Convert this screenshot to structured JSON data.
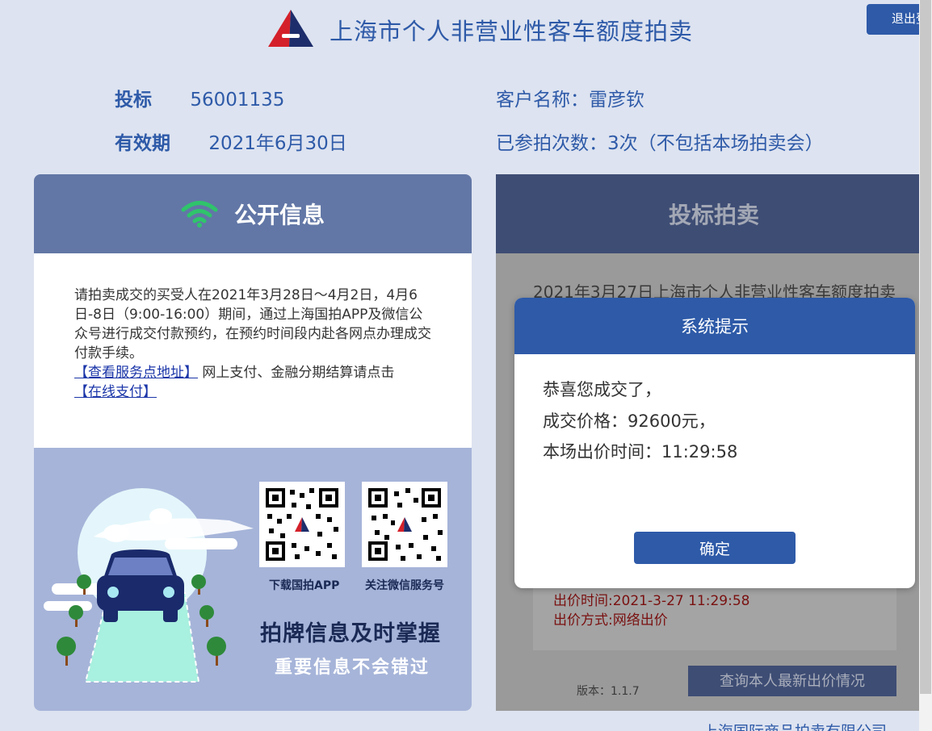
{
  "header": {
    "title": "上海市个人非营业性客车额度拍卖",
    "logout_label": "退出登"
  },
  "user": {
    "bid_no_label": "投标",
    "bid_no": "56001135",
    "valid_label": "有效期",
    "valid_date": "2021年6月30日",
    "customer_label": "客户名称：",
    "customer_name": "雷彦钦",
    "participation_label": "已参拍次数：",
    "participation_value": "3次（不包括本场拍卖会）"
  },
  "public_info": {
    "title": "公开信息",
    "notice_text": "请拍卖成交的买受人在2021年3月28日～4月2日，4月6日-8日（9:00-16:00）期间，通过上海国拍APP及微信公众号进行成交付款预约，在预约时间段内赴各网点办理成交付款手续。",
    "service_link": "【查看服务点地址】",
    "middle_text": " 网上支付、金融分期结算请点击",
    "pay_link": "【在线支付】",
    "qr_app_label": "下载国拍APP",
    "qr_wechat_label": "关注微信服务号",
    "promo_title": "拍牌信息及时掌握",
    "promo_subtitle": "重要信息不会错过"
  },
  "auction": {
    "title": "投标拍卖",
    "auction_name": "2021年3月27日上海市个人非营业性客车额度拍卖",
    "bid_time": "出价时间:2021-3-27 11:29:58",
    "bid_method": "出价方式:网络出价",
    "version": "版本：1.1.7",
    "query_button": "查询本人最新出价情况"
  },
  "modal": {
    "title": "系统提示",
    "line1": "恭喜您成交了，",
    "line2": "成交价格：92600元，",
    "line3": "本场出价时间：11:29:58",
    "confirm": "确定"
  },
  "footer": {
    "company": "上海国际商品拍卖有限公司"
  },
  "colors": {
    "primary": "#2e5aa8",
    "page_bg": "#dde3f0",
    "wifi_green": "#2fc46b"
  }
}
